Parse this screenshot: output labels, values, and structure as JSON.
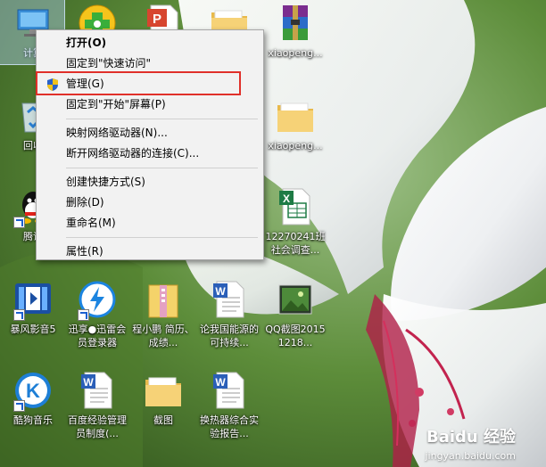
{
  "desktop": {
    "icons": [
      {
        "label": "计算",
        "icon": "computer-icon"
      },
      {
        "label": "",
        "icon": "360-security-icon"
      },
      {
        "label": "",
        "icon": "wps-presentation-icon"
      },
      {
        "label": "",
        "icon": "folder-icon"
      },
      {
        "label": "xiaopeng...",
        "icon": "winrar-archive-icon"
      },
      {
        "label": "回收",
        "icon": "recycle-bin-icon"
      },
      {
        "label": "xiaopeng...",
        "icon": "folder-icon"
      },
      {
        "label": "腾讯",
        "icon": "qq-icon"
      },
      {
        "label": "12270241班社会调查...",
        "icon": "excel-file-icon"
      },
      {
        "label": "暴风影音5",
        "icon": "baofeng-player-icon"
      },
      {
        "label": "迅享●迅雷会员登录器",
        "icon": "xunlei-icon"
      },
      {
        "label": "程小鹏 简历、成绩...",
        "icon": "zip-archive-icon"
      },
      {
        "label": "论我国能源的可持续...",
        "icon": "word-document-icon"
      },
      {
        "label": "QQ截图20151218...",
        "icon": "image-file-icon"
      },
      {
        "label": "酷狗音乐",
        "icon": "kugou-music-icon"
      },
      {
        "label": "百度经验管理员制度(...",
        "icon": "word-document-icon"
      },
      {
        "label": "截图",
        "icon": "folder-icon"
      },
      {
        "label": "换热器综合实验报告...",
        "icon": "word-document-icon"
      }
    ]
  },
  "context_menu": {
    "items": [
      {
        "label": "打开(O)",
        "bold": true
      },
      {
        "label": "固定到\"快速访问\""
      },
      {
        "label": "管理(G)",
        "icon": "uac-shield-icon"
      },
      {
        "label": "固定到\"开始\"屏幕(P)"
      },
      {
        "label": "映射网络驱动器(N)..."
      },
      {
        "label": "断开网络驱动器的连接(C)..."
      },
      {
        "label": "创建快捷方式(S)"
      },
      {
        "label": "删除(D)"
      },
      {
        "label": "重命名(M)"
      },
      {
        "label": "属性(R)"
      }
    ]
  },
  "watermark": {
    "text": "Baidu 经验",
    "url": "jingyan.baidu.com"
  },
  "colors": {
    "highlight": "#e0302a",
    "menu_bg": "#f2f2f2"
  }
}
